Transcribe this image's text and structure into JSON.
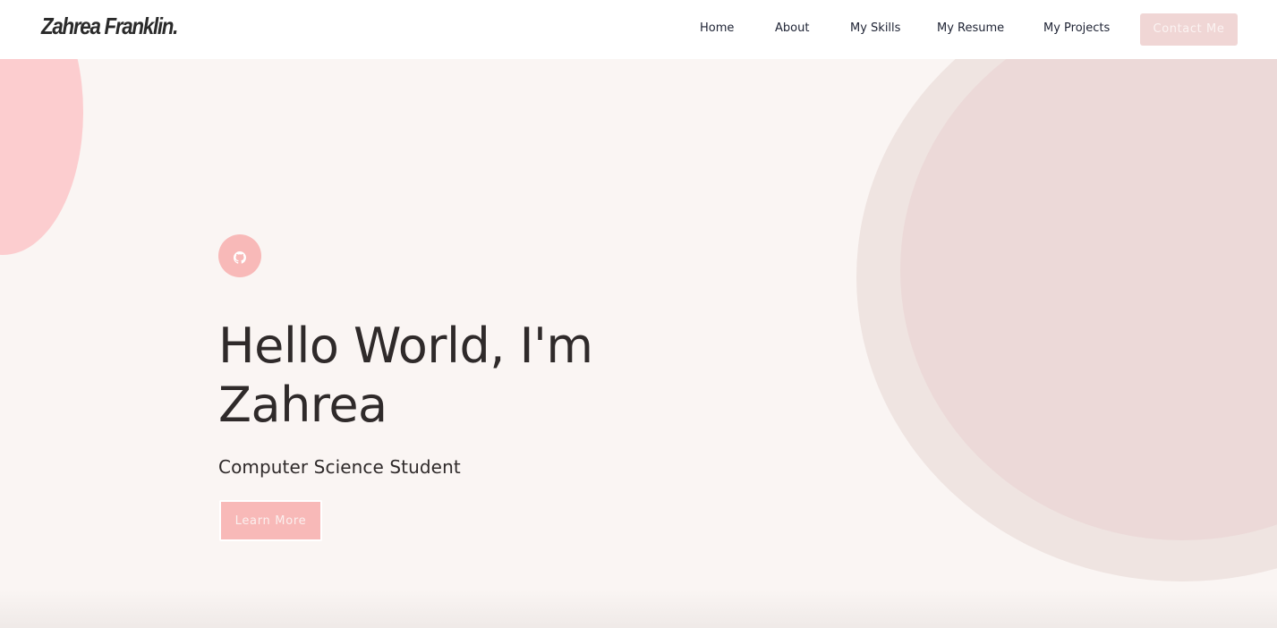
{
  "header": {
    "logo_text": "Zahrea Franklin.",
    "nav": {
      "home": "Home",
      "about": "About",
      "skills": "My Skills",
      "resume": "My Resume",
      "projects": "My Projects"
    },
    "contact_label": "Contact Me"
  },
  "hero": {
    "social_icon": "github-icon",
    "title_line1": "Hello World, I'm",
    "title_line2": "Zahrea",
    "subtitle": "Computer Science Student",
    "cta_label": "Learn More"
  },
  "colors": {
    "accent_pink": "#f8b9b8",
    "background": "#faf5f3",
    "contact_button": "#f0d6d5",
    "text_dark": "#2f2a2a",
    "nav_text": "#1d2233"
  }
}
